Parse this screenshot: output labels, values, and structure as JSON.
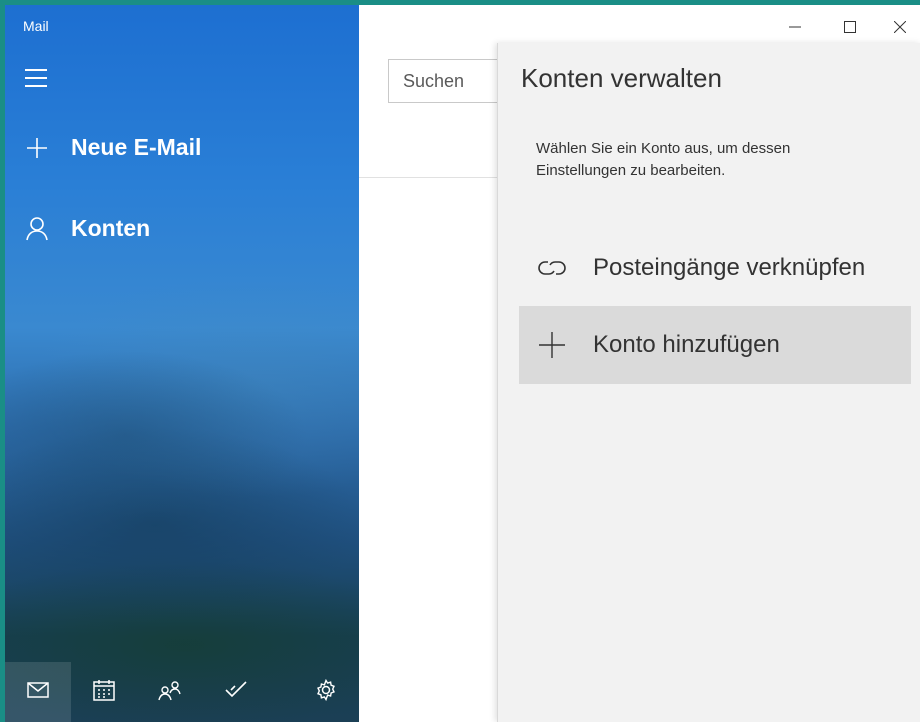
{
  "app": {
    "title": "Mail"
  },
  "nav": {
    "new_mail_label": "Neue E-Mail",
    "accounts_label": "Konten",
    "bottom_icons": [
      "mail-icon",
      "calendar-icon",
      "people-icon",
      "todo-icon",
      "settings-icon"
    ],
    "active_bottom": "mail-icon"
  },
  "search": {
    "placeholder": "Suchen"
  },
  "flyout": {
    "title": "Konten verwalten",
    "description": "Wählen Sie ein Konto aus, um dessen Einstellungen zu bearbeiten.",
    "options": [
      {
        "label": "Posteingänge verknüpfen",
        "icon": "link-icon"
      },
      {
        "label": "Konto hinzufügen",
        "icon": "plus-icon"
      }
    ]
  },
  "colors": {
    "frame": "#1a8e86",
    "nav_blue": "#1d6fd1",
    "flyout_bg": "#f2f2f2",
    "selected_option_bg": "#dadada"
  }
}
